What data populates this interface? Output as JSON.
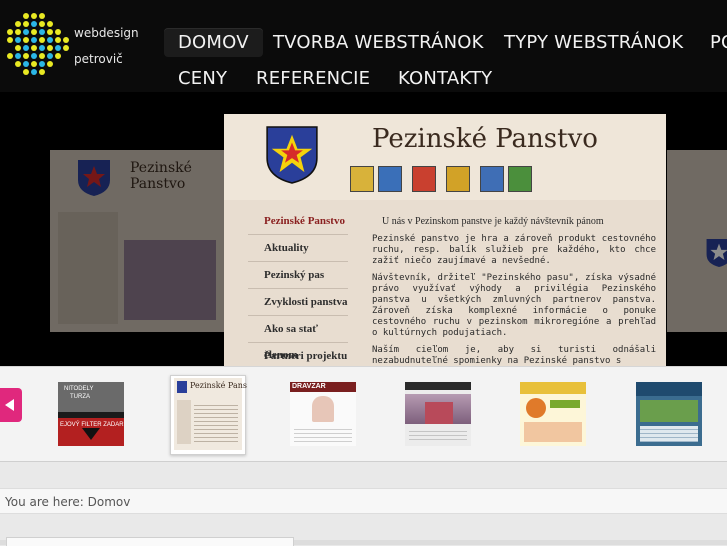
{
  "logo": {
    "line1": "webdesign",
    "line2": "petrovič"
  },
  "nav": {
    "row1": [
      "DOMOV",
      "TVORBA WEBSTRÁNOK",
      "TYPY WEBSTRÁNOK",
      "PO"
    ],
    "row2": [
      "CENY",
      "REFERENCIE",
      "KONTAKTY"
    ],
    "active": "DOMOV"
  },
  "slide": {
    "title": "Pezinské Panstvo",
    "menu": [
      "Pezinské Panstvo",
      "Aktuality",
      "Pezinský pas",
      "Zvyklosti panstva",
      "Ako sa stať členom",
      "Partneri projektu"
    ],
    "headline": "U nás v Pezinskom panstve je každý návštevník pánom",
    "paragraphs": [
      "Pezinské panstvo je hra a zároveň produkt cestovného ruchu, resp. balík služieb pre každého, kto chce zažiť niečo zaujímavé a nevšedné.",
      "Návštevník, držiteľ \"Pezinského pasu\", získa výsadné právo využívať výhody a privilégia Pezinského panstva u všetkých zmluvných partnerov panstva. Zároveň získa komplexné informácie o ponuke cestovného ruchu v pezinskom mikroregióne a prehľad o kultúrnych podujatiach.",
      "Naším cieľom je, aby si turisti odnášali nezabudnuteľné spomienky na Pezinské panstvo s"
    ]
  },
  "thumbnails": {
    "t1": {
      "line1": "NITODELY",
      "line2": "TURZA",
      "line3": "EJOVÝ FILTER ZADAR"
    },
    "t2": {
      "label": "Pezinské Pans"
    },
    "t3": {
      "label": "DRAVZAR"
    }
  },
  "breadcrumb": {
    "prefix": "You are here:",
    "current": "Domov"
  },
  "colors": {
    "accent": "#e0287d",
    "logo_dot": "#e9e923",
    "logo_dot_alt": "#2bb6e6"
  },
  "icons": {
    "left_arrow": "arrow-left-icon"
  }
}
